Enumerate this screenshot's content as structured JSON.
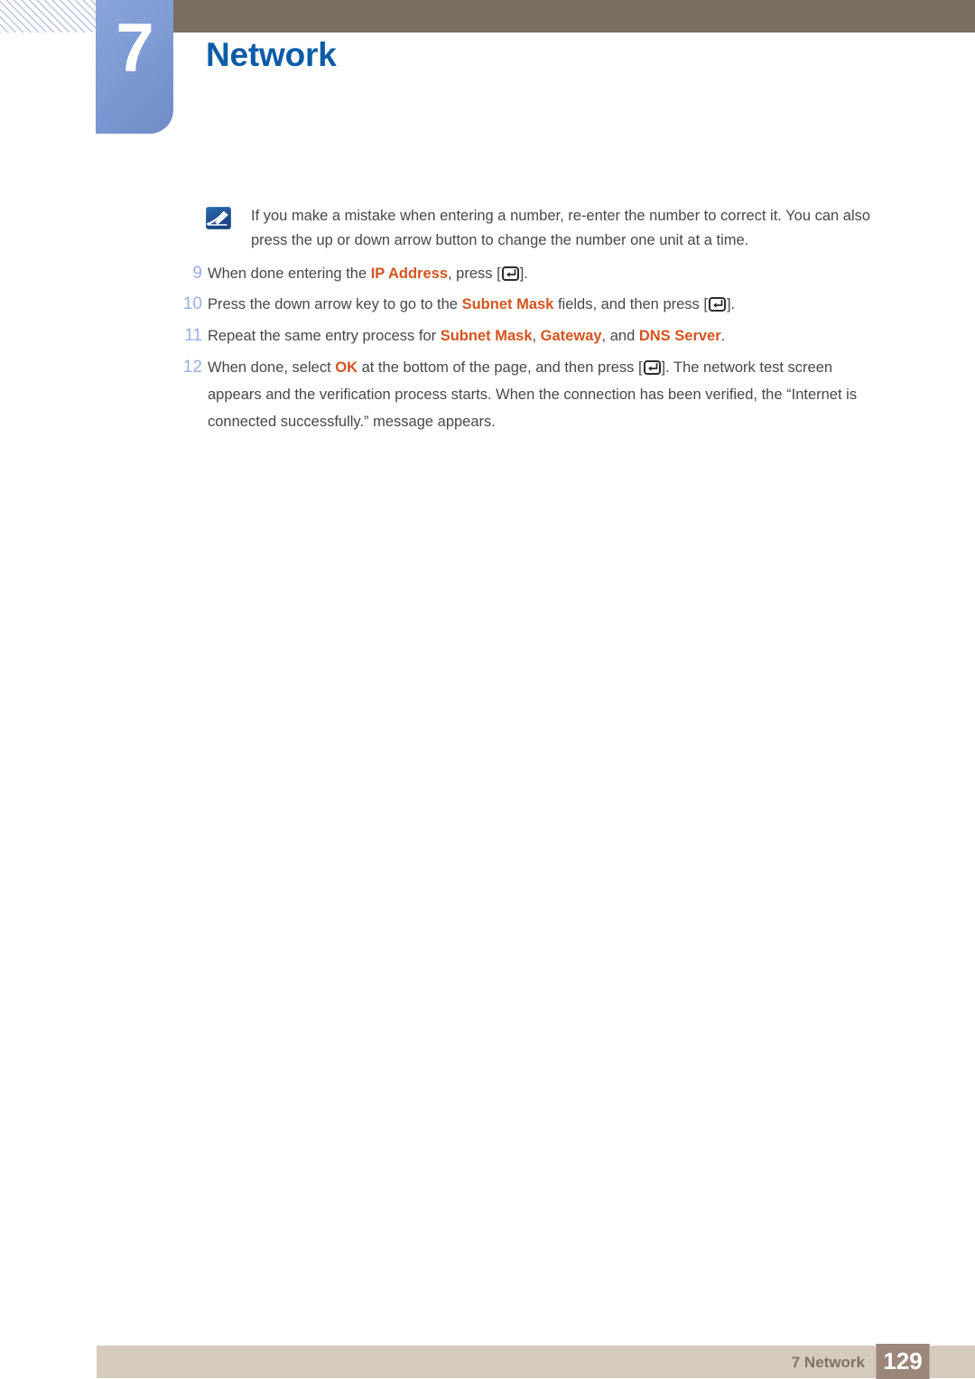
{
  "header": {
    "chapter_number": "7",
    "chapter_title": "Network",
    "accent_blue": "#0a5ca8",
    "tab_blue": "#7e9bd4",
    "topbar_brown": "#7b6d60"
  },
  "note": {
    "icon_name": "note-pencil-icon",
    "line1": "If you make a mistake when entering a number, re-enter the number to correct it. You can also",
    "line2": "press the up or down arrow button to change the number one unit at a time."
  },
  "steps": [
    {
      "number": "9",
      "lines": [
        [
          {
            "t": "When done entering the ",
            "s": "normal"
          },
          {
            "t": "IP Address",
            "s": "highlight"
          },
          {
            "t": ", press [",
            "s": "normal"
          },
          {
            "t": "",
            "s": "enterkey"
          },
          {
            "t": "].",
            "s": "normal"
          }
        ]
      ]
    },
    {
      "number": "10",
      "lines": [
        [
          {
            "t": "Press the down arrow key to go to the ",
            "s": "normal"
          },
          {
            "t": "Subnet Mask",
            "s": "highlight"
          },
          {
            "t": " fields, and then press [",
            "s": "normal"
          },
          {
            "t": "",
            "s": "enterkey"
          },
          {
            "t": "].",
            "s": "normal"
          }
        ]
      ]
    },
    {
      "number": "11",
      "lines": [
        [
          {
            "t": "Repeat the same entry process for ",
            "s": "normal"
          },
          {
            "t": "Subnet Mask",
            "s": "highlight"
          },
          {
            "t": ", ",
            "s": "normal"
          },
          {
            "t": "Gateway",
            "s": "highlight"
          },
          {
            "t": ", and ",
            "s": "normal"
          },
          {
            "t": "DNS Server",
            "s": "highlight"
          },
          {
            "t": ".",
            "s": "normal"
          }
        ]
      ]
    },
    {
      "number": "12",
      "lines": [
        [
          {
            "t": "When done, select ",
            "s": "normal"
          },
          {
            "t": "OK",
            "s": "highlight"
          },
          {
            "t": " at the bottom of the page, and then press [",
            "s": "normal"
          },
          {
            "t": "",
            "s": "enterkey"
          },
          {
            "t": "]. The network test screen",
            "s": "normal"
          }
        ],
        [
          {
            "t": "appears and the verification process starts. When the connection has been verified, the “Internet is",
            "s": "normal"
          }
        ],
        [
          {
            "t": "connected successfully.” message appears.",
            "s": "normal"
          }
        ]
      ]
    }
  ],
  "footer": {
    "label": "7 Network",
    "page_number": "129",
    "bar_color": "#d6cbba",
    "page_box_color": "#9b8679"
  },
  "colors": {
    "highlight_orange": "#d4541f",
    "step_number_blue": "#9bafe0",
    "body_gray": "#45484a"
  }
}
